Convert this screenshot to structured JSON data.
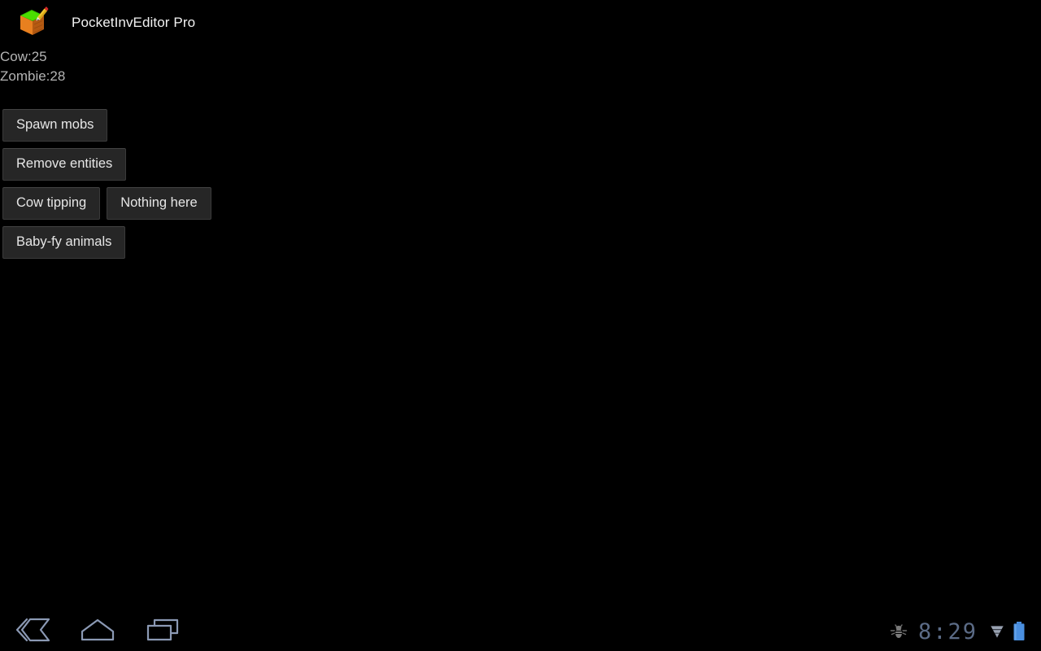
{
  "app": {
    "title": "PocketInvEditor Pro",
    "icon_name": "grass-block-pencil-icon"
  },
  "counters": [
    {
      "label": "Cow:25"
    },
    {
      "label": "Zombie:28"
    }
  ],
  "buttons": {
    "rows": [
      [
        {
          "label": "Spawn mobs",
          "name": "spawn-mobs-button"
        }
      ],
      [
        {
          "label": "Remove entities",
          "name": "remove-entities-button"
        }
      ],
      [
        {
          "label": "Cow tipping",
          "name": "cow-tipping-button"
        },
        {
          "label": "Nothing here",
          "name": "nothing-here-button"
        }
      ],
      [
        {
          "label": "Baby-fy animals",
          "name": "baby-fy-animals-button"
        }
      ]
    ]
  },
  "system_bar": {
    "nav": [
      {
        "name": "back-icon",
        "label": "Back"
      },
      {
        "name": "home-icon",
        "label": "Home"
      },
      {
        "name": "recents-icon",
        "label": "Recent apps"
      }
    ],
    "status": {
      "debug_icon": "usb-debug-bug-icon",
      "clock": "8:29",
      "signal_icon": "wifi-signal-icon",
      "battery_icon": "battery-full-icon"
    }
  },
  "colors": {
    "background": "#000000",
    "button_bg": "#262626",
    "button_border": "#3a3a3a",
    "button_text": "#e6e6e6",
    "counter_text": "#b4b4b4",
    "title_text": "#f2f2f2",
    "nav_icon": "#8f9cb5",
    "clock_text": "#5b6b86",
    "battery_blue": "#4a8fe0",
    "grass_green": "#3fd400",
    "dirt_orange": "#e0701a",
    "pencil_yellow": "#f0c020"
  }
}
